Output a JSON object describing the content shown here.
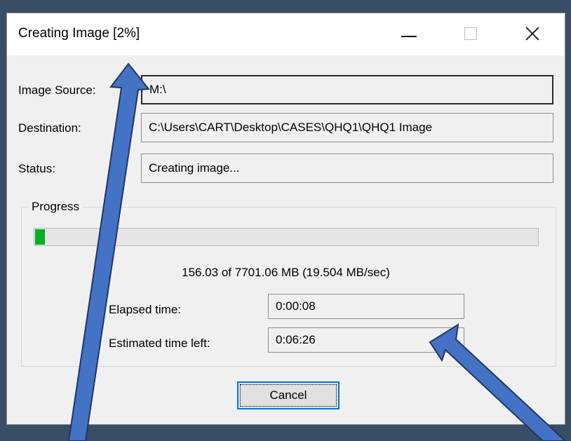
{
  "window": {
    "title": "Creating Image [2%]",
    "controls": {
      "minimize": "minimize-icon",
      "maximize": "maximize-icon",
      "close": "close-icon"
    }
  },
  "fields": {
    "source_label": "Image Source:",
    "source_value": "M:\\",
    "destination_label": "Destination:",
    "destination_value": "C:\\Users\\CART\\Desktop\\CASES\\QHQ1\\QHQ1 Image",
    "status_label": "Status:",
    "status_value": "Creating image..."
  },
  "progress": {
    "group_label": "Progress",
    "percent": 2,
    "stats": "156.03 of 7701.06 MB (19.504 MB/sec)",
    "elapsed_label": "Elapsed time:",
    "elapsed_value": "0:00:08",
    "remaining_label": "Estimated time left:",
    "remaining_value": "0:06:26"
  },
  "buttons": {
    "cancel": "Cancel"
  },
  "colors": {
    "slide_background": "#3a4d66",
    "progress_fill": "#06b025",
    "arrow_fill": "#4472c4",
    "arrow_stroke": "#1f3864",
    "focus_border": "#0078d7"
  }
}
